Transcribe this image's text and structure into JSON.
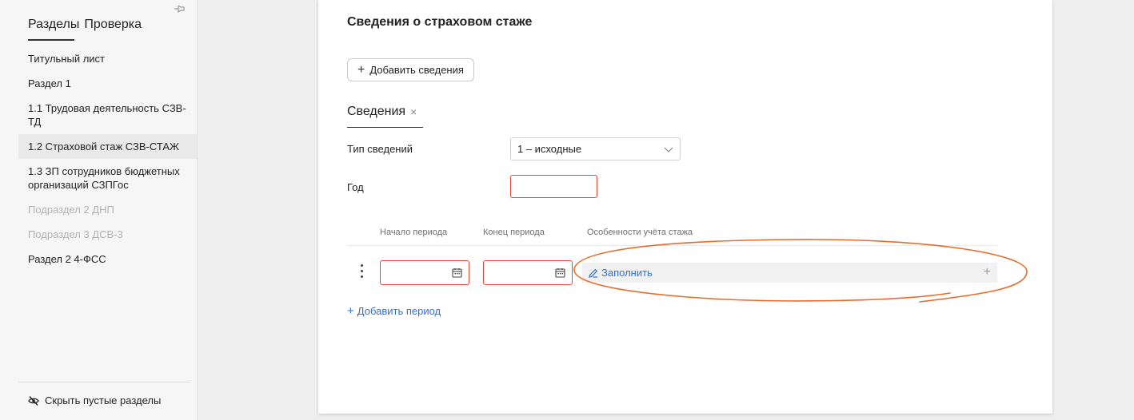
{
  "sidebar": {
    "tabs": [
      "Разделы",
      "Проверка"
    ],
    "items": [
      {
        "label": "Титульный лист"
      },
      {
        "label": "Раздел 1"
      },
      {
        "label": "1.1 Трудовая деятельность СЗВ-ТД"
      },
      {
        "label": "1.2 Страховой стаж СЗВ-СТАЖ"
      },
      {
        "label": "1.3 ЗП сотрудников бюджетных организаций СЗПГос"
      },
      {
        "label": "Подраздел 2 ДНП"
      },
      {
        "label": "Подраздел 3 ДСВ-3"
      },
      {
        "label": "Раздел 2 4-ФСС"
      }
    ],
    "hide_empty_label": "Скрыть пустые разделы"
  },
  "main": {
    "title": "Сведения о страховом стаже",
    "add_info_label": "Добавить сведения",
    "section_tab_label": "Сведения",
    "form": {
      "type_label": "Тип сведений",
      "type_value": "1 – исходные",
      "year_label": "Год",
      "year_value": ""
    },
    "table": {
      "columns": [
        "Начало периода",
        "Конец периода",
        "Особенности учёта стажа"
      ],
      "row": {
        "start": "",
        "end": "",
        "fill_label": "Заполнить"
      }
    },
    "add_period_label": "Добавить период"
  },
  "colors": {
    "accent": "#2f6fce",
    "error_border": "#e2473a",
    "annotation": "#e96b2b"
  }
}
